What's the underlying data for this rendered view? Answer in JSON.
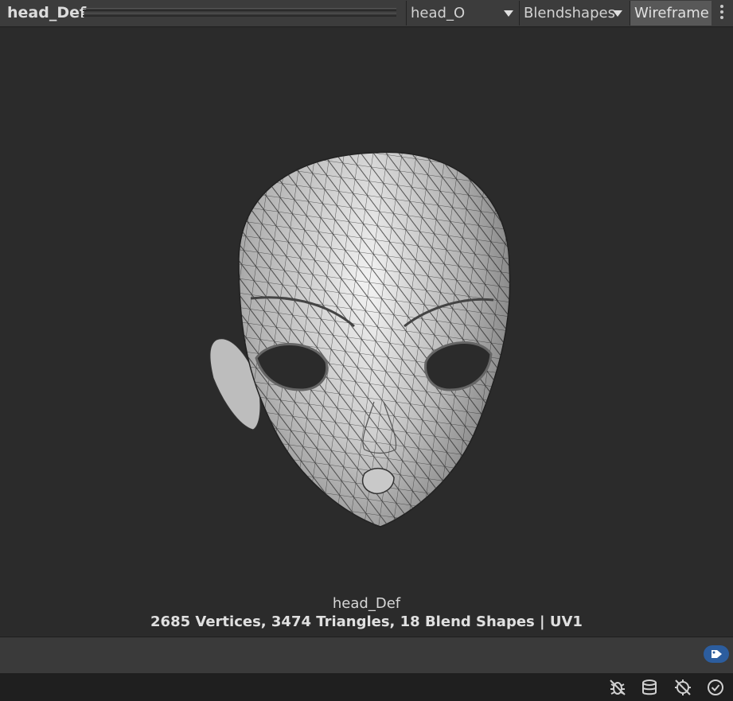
{
  "toolbar": {
    "title": "head_Def",
    "submesh_dropdown": "head_O",
    "blendshapes_dropdown": "Blendshapes",
    "wireframe_button": "Wireframe"
  },
  "preview": {
    "mesh_name": "head_Def",
    "mesh_info": "2685 Vertices, 3474 Triangles, 18 Blend Shapes | UV1"
  },
  "icons": {
    "tag": "tag-icon",
    "status": [
      "bug-icon",
      "layers-icon",
      "network-icon",
      "check-circle-icon"
    ]
  },
  "colors": {
    "accent": "#2c5d9e",
    "toolbar": "#3c3c3c",
    "viewport": "#2b2b2b"
  }
}
